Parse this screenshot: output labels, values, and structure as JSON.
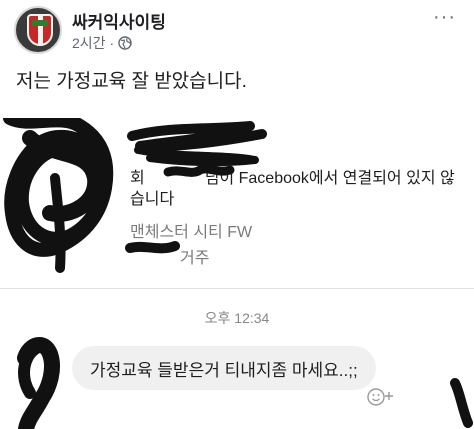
{
  "post": {
    "page_name": "싸커익사이팅",
    "time": "2시간",
    "separator": "·",
    "more_label": "···",
    "text": "저는 가정교육 잘 받았습니다.",
    "colors": {
      "crest_red": "#c62828",
      "crest_green": "#2e7d32"
    }
  },
  "screenshot": {
    "card": {
      "title_start": "회",
      "title_end": "님이 Facebook에서 연결되어 있지 않습니다",
      "subtitle": "맨체스터 시티 FW",
      "location": "거주"
    },
    "timestamp": "오후 12:34",
    "message": "가정교육 들받은거 티내지좀 마세요..;;"
  },
  "icons": {
    "globe": "globe-icon",
    "more": "more-options-icon",
    "react": "emoji-reaction-icon"
  }
}
